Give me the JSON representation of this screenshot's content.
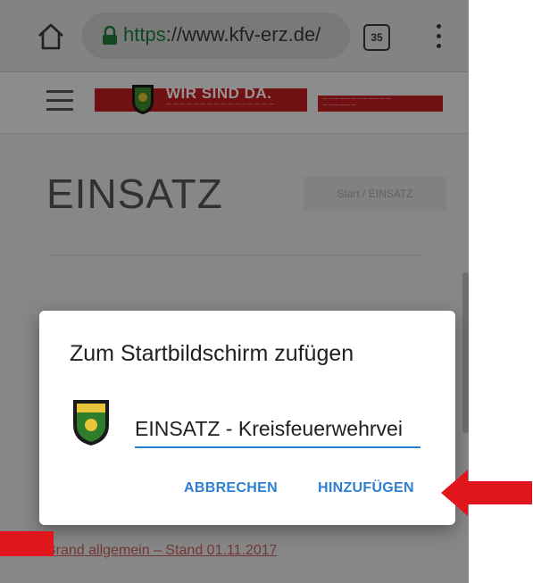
{
  "browser": {
    "url_scheme": "https",
    "url_rest": "://www.kfv-erz.de/",
    "tab_count": "35"
  },
  "site": {
    "banner_main": "WIR SIND DA.",
    "page_title": "EINSATZ",
    "breadcrumb": "Start  /  EINSATZ",
    "link_text": "Brand allgemein – Stand 01.11.2017"
  },
  "dialog": {
    "title": "Zum Startbildschirm zufügen",
    "input_value": "EINSATZ - Kreisfeuerwehrvei",
    "cancel_label": "ABBRECHEN",
    "add_label": "HINZUFÜGEN"
  },
  "colors": {
    "accent": "#2d7fd1",
    "arrow": "#e0161c",
    "banner_red": "#c41e23"
  }
}
